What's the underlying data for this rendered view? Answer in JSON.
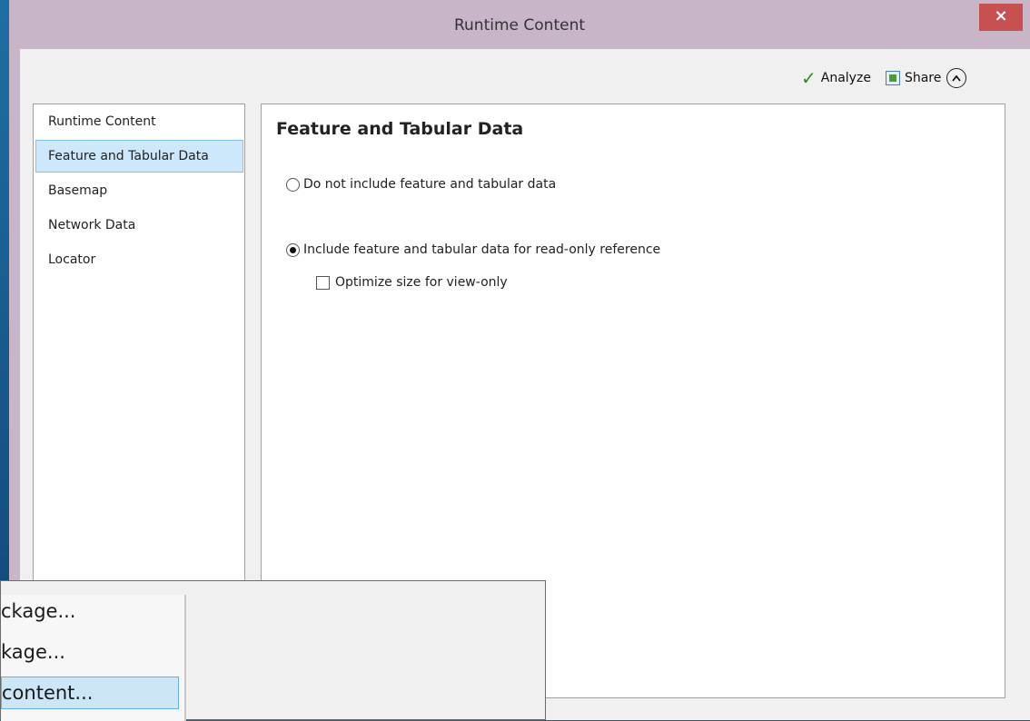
{
  "window": {
    "title": "Runtime Content",
    "close_label": "×"
  },
  "toolbar": {
    "analyze_label": "Analyze",
    "share_label": "Share",
    "collapse_glyph": "^"
  },
  "sidebar": {
    "items": [
      {
        "label": "Runtime Content",
        "selected": false
      },
      {
        "label": "Feature and Tabular Data",
        "selected": true
      },
      {
        "label": "Basemap",
        "selected": false
      },
      {
        "label": "Network Data",
        "selected": false
      },
      {
        "label": "Locator",
        "selected": false
      }
    ]
  },
  "main": {
    "section_title": "Feature and Tabular Data",
    "options": {
      "exclude_label": "Do not include feature and tabular data",
      "exclude_checked": false,
      "include_label": "Include feature and tabular data for read-only reference",
      "include_checked": true,
      "optimize_label": "Optimize size for view-only",
      "optimize_checked": false
    }
  },
  "context_menu": {
    "items": [
      {
        "label": "ckage...",
        "highlighted": false
      },
      {
        "label": "kage...",
        "highlighted": false
      },
      {
        "label": " content...",
        "highlighted": true
      }
    ]
  },
  "colors": {
    "accent": "#cde8fb",
    "close": "#c75050",
    "frame": "#c8b5c8",
    "analyze_check": "#2e8b22"
  }
}
